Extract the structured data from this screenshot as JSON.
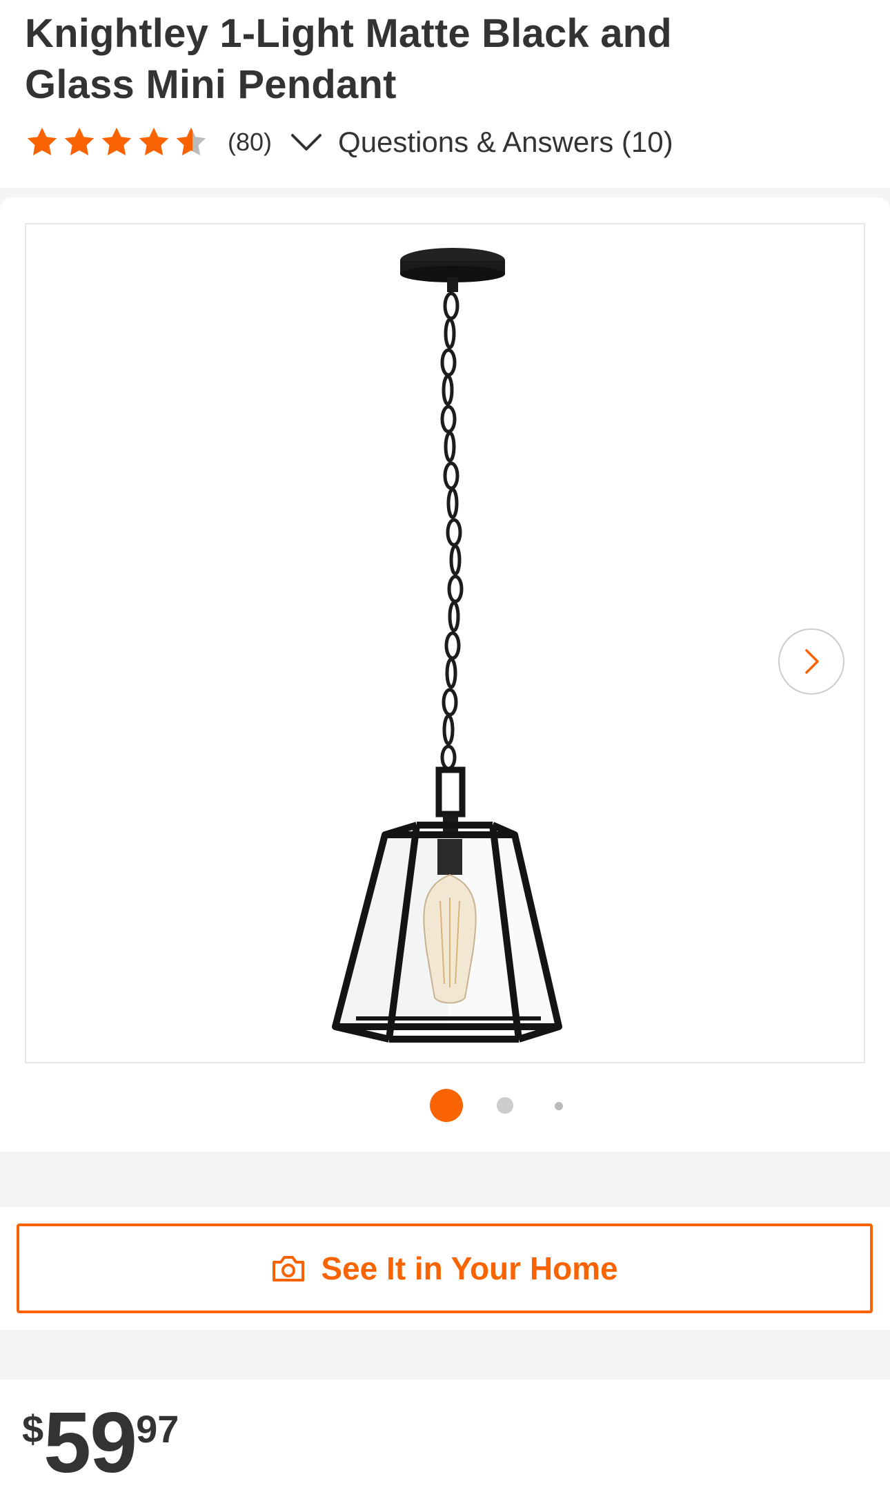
{
  "product": {
    "title_line1": "Knightley 1-Light Matte Black and",
    "title_line2": "Glass Mini Pendant"
  },
  "ratings": {
    "stars": 4.5,
    "review_count": "(80)",
    "qa_label": "Questions & Answers (10)"
  },
  "gallery": {
    "image_icon": "pendant-light-product-image",
    "next_icon": "chevron-right-icon",
    "dot_count": 3,
    "active_dot": 1
  },
  "ar_button": {
    "label": "See It in Your Home",
    "icon": "camera-icon"
  },
  "price": {
    "symbol": "$",
    "dollars": "59",
    "cents": "97"
  },
  "colors": {
    "accent": "#f96302",
    "text": "#333333",
    "star_empty": "#bbbbbb",
    "band": "#f4f4f4"
  }
}
